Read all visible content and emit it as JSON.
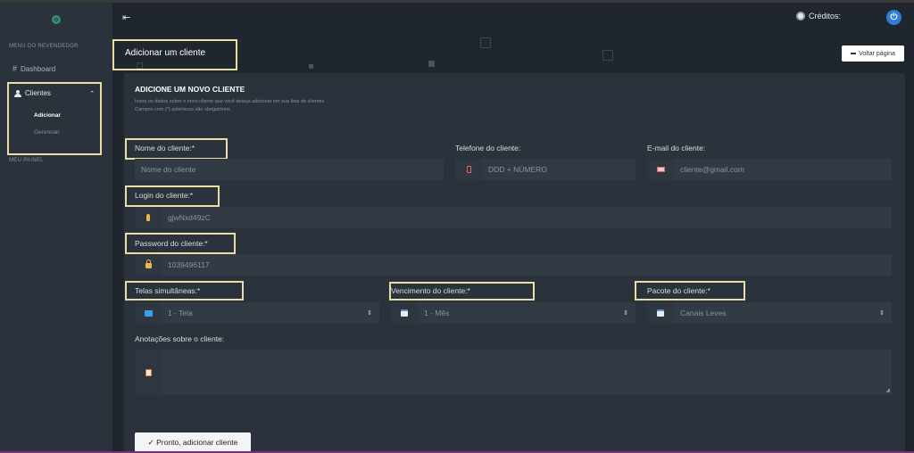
{
  "sidebar": {
    "heading_reseller": "MENU DO REVENDEDOR",
    "dashboard": "Dashboard",
    "clients": "Clientes",
    "sub_add": "Adicionar",
    "sub_manage": "Gerenciar",
    "heading_panel": "MEU PAINEL"
  },
  "header": {
    "credits": "Créditos:"
  },
  "page": {
    "title": "Adicionar um cliente",
    "back_button": "Voltar página"
  },
  "form": {
    "heading": "ADICIONE UM NOVO CLIENTE",
    "desc1": "Insira os dados sobre o novo cliente que você deseja adicionar em sua lista de clientes.",
    "desc2": "Campos com (*) asteriscos são obrigatórios.",
    "name_label": "Nome do cliente:*",
    "name_placeholder": "Nome do cliente",
    "phone_label": "Telefone do cliente:",
    "phone_placeholder": "DDD + NÚMERO",
    "email_label": "E-mail do cliente:",
    "email_placeholder": "cliente@gmail.com",
    "login_label": "Login do cliente:*",
    "login_value": "gjwNxd49zC",
    "password_label": "Password do cliente:*",
    "password_value": "1039496117",
    "screens_label": "Telas simultâneas:*",
    "screens_value": "1 - Tela",
    "expiry_label": "Vencimento do cliente:*",
    "expiry_value": "1 - Mês",
    "package_label": "Pacote do cliente:*",
    "package_value": "Canais Leves",
    "notes_label": "Anotações sobre o cliente:",
    "submit": "✓ Pronto, adicionar cliente"
  },
  "icons": {
    "menu_toggle": "menu-collapse-icon",
    "credits": "coin-icon",
    "power": "power-icon"
  }
}
